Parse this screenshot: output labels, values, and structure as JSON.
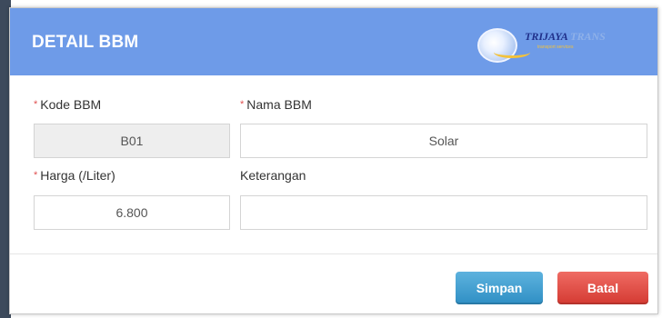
{
  "dialog": {
    "title": "DETAIL BBM",
    "logo": {
      "brand_main": "TRIJAYA",
      "brand_accent": "TRANS",
      "tagline": "transport services"
    }
  },
  "form": {
    "kode": {
      "required_mark": "*",
      "label": "Kode BBM",
      "value": "B01"
    },
    "nama": {
      "required_mark": "*",
      "label": "Nama BBM",
      "value": "Solar"
    },
    "harga": {
      "required_mark": "*",
      "label": "Harga (/Liter)",
      "value": "6.800"
    },
    "keterangan": {
      "label": "Keterangan",
      "value": ""
    }
  },
  "buttons": {
    "save_label": "Simpan",
    "cancel_label": "Batal"
  },
  "colors": {
    "header": "#6e9be8",
    "save": "#3b9ad0",
    "cancel": "#e04a42",
    "required": "#e05050"
  }
}
